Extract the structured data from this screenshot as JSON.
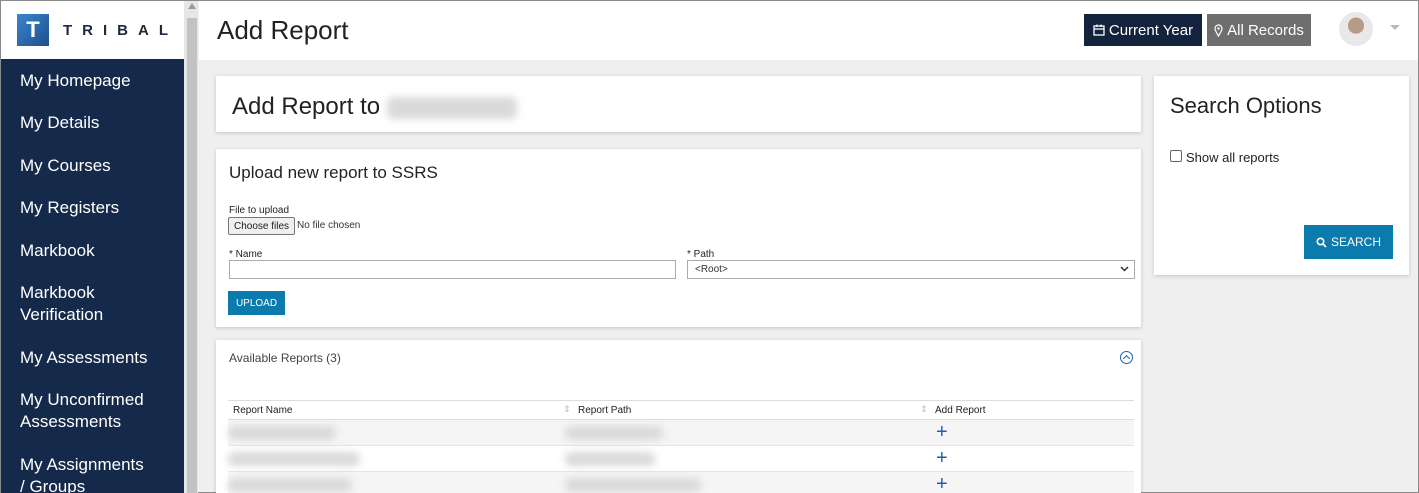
{
  "brand": {
    "logo_letter": "T",
    "logo_text": "TRIBAL"
  },
  "sidebar": {
    "items": [
      {
        "label": "My Homepage"
      },
      {
        "label": "My Details"
      },
      {
        "label": "My Courses"
      },
      {
        "label": "My Registers"
      },
      {
        "label": "Markbook"
      },
      {
        "label": "Markbook Verification"
      },
      {
        "label": "My Assessments"
      },
      {
        "label": "My Unconfirmed Assessments"
      },
      {
        "label": "My Assignments / Groups"
      }
    ]
  },
  "header": {
    "title": "Add Report",
    "current_year_label": "Current Year",
    "all_records_label": "All Records"
  },
  "add_report": {
    "title": "Add Report to"
  },
  "upload": {
    "title": "Upload new report to SSRS",
    "file_label": "File to upload",
    "choose_label": "Choose files",
    "no_file_text": "No file chosen",
    "name_label": "* Name",
    "name_value": "",
    "path_label": "* Path",
    "path_value": "<Root>",
    "upload_label": "UPLOAD"
  },
  "reports": {
    "title": "Available Reports (3)",
    "columns": [
      "Report Name",
      "Report Path",
      "Add Report"
    ],
    "add_symbol": "+"
  },
  "search_options": {
    "title": "Search Options",
    "show_all_label": "Show all reports",
    "show_all_checked": false,
    "search_label": "SEARCH"
  },
  "colors": {
    "sidebar_bg": "#15294a",
    "accent": "#0b7bae",
    "dark_button": "#13223d",
    "grey_button": "#6e6e6e"
  },
  "icons": [
    "calendar-icon",
    "map-marker-icon",
    "search-icon",
    "chevron-up-circle-icon",
    "sort-icon",
    "plus-icon",
    "chevron-down-icon"
  ]
}
